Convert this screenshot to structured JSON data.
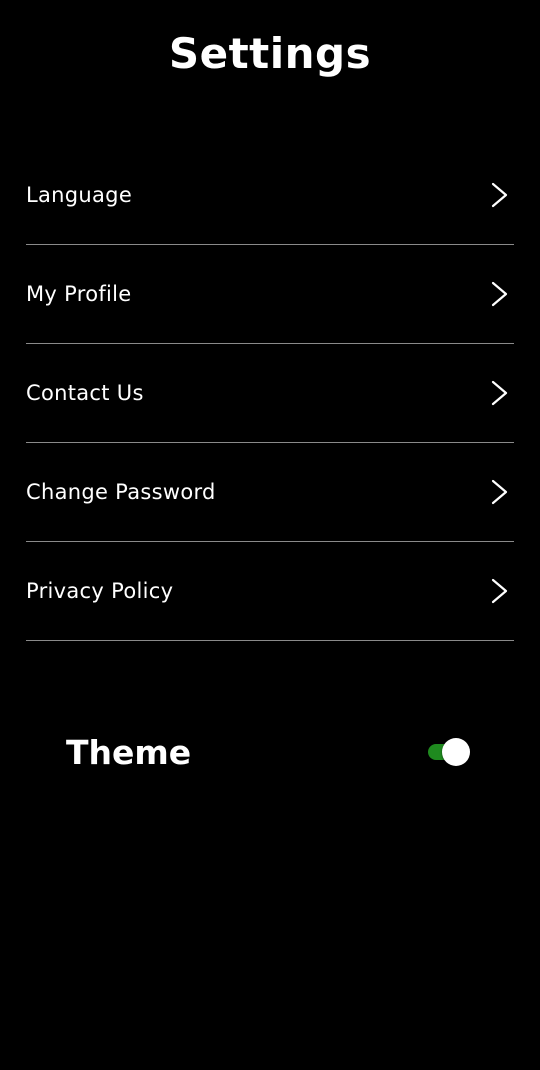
{
  "header": {
    "title": "Settings"
  },
  "menu": {
    "items": [
      {
        "label": "Language",
        "icon": "chevron-right-icon"
      },
      {
        "label": "My Profile",
        "icon": "chevron-right-icon"
      },
      {
        "label": "Contact Us",
        "icon": "chevron-right-icon"
      },
      {
        "label": "Change Password",
        "icon": "chevron-right-icon"
      },
      {
        "label": "Privacy Policy",
        "icon": "chevron-right-icon"
      }
    ]
  },
  "theme": {
    "label": "Theme",
    "enabled": true
  },
  "colors": {
    "background": "#000000",
    "text": "#ffffff",
    "divider": "#8a8a8a",
    "toggle_on": "#1f8a1f",
    "toggle_thumb": "#ffffff"
  }
}
